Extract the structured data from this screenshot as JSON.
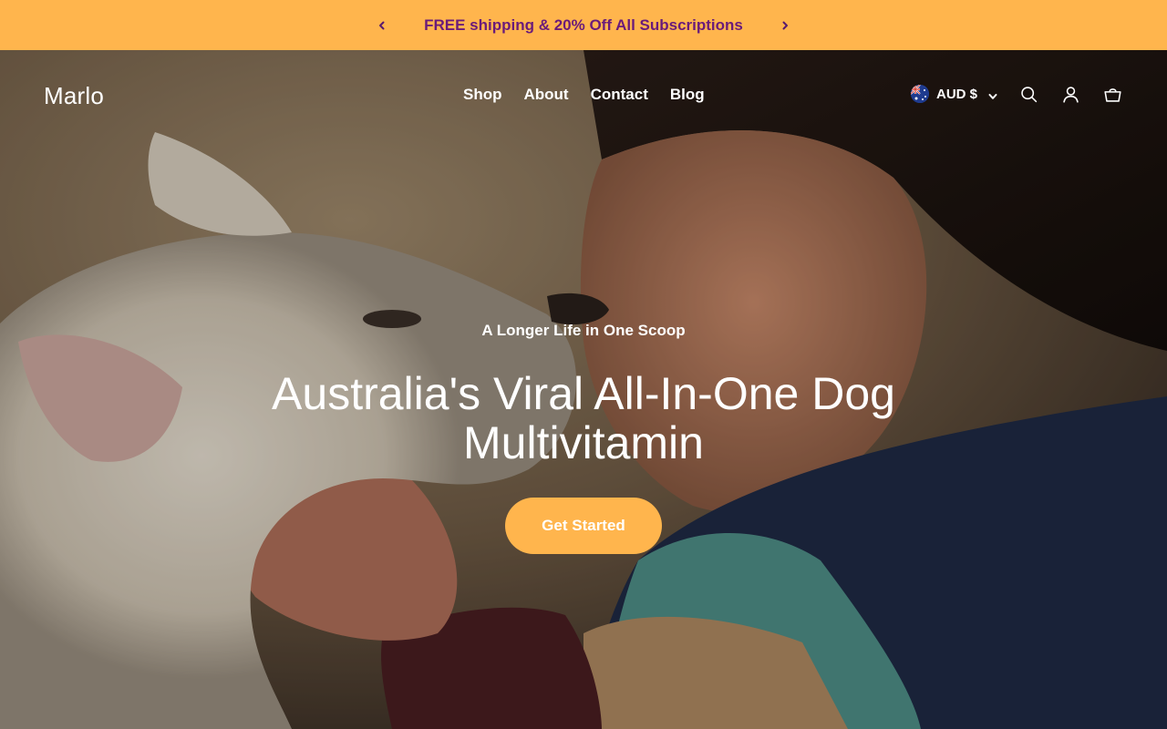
{
  "announcement": {
    "text": "FREE shipping & 20% Off All Subscriptions",
    "prev_icon": "chevron-left-icon",
    "next_icon": "chevron-right-icon",
    "background": "#ffb54d",
    "text_color": "#6a1b7a"
  },
  "header": {
    "logo": "Marlo",
    "nav": [
      {
        "label": "Shop"
      },
      {
        "label": "About"
      },
      {
        "label": "Contact"
      },
      {
        "label": "Blog"
      }
    ],
    "currency": {
      "label": "AUD $",
      "flag": "australia-flag-icon"
    },
    "icons": [
      "search-icon",
      "account-icon",
      "cart-icon"
    ]
  },
  "hero": {
    "tagline": "A Longer Life in One Scoop",
    "headline": "Australia's Viral All-In-One Dog Multivitamin",
    "cta_label": "Get Started",
    "accent": "#ffb54d"
  }
}
